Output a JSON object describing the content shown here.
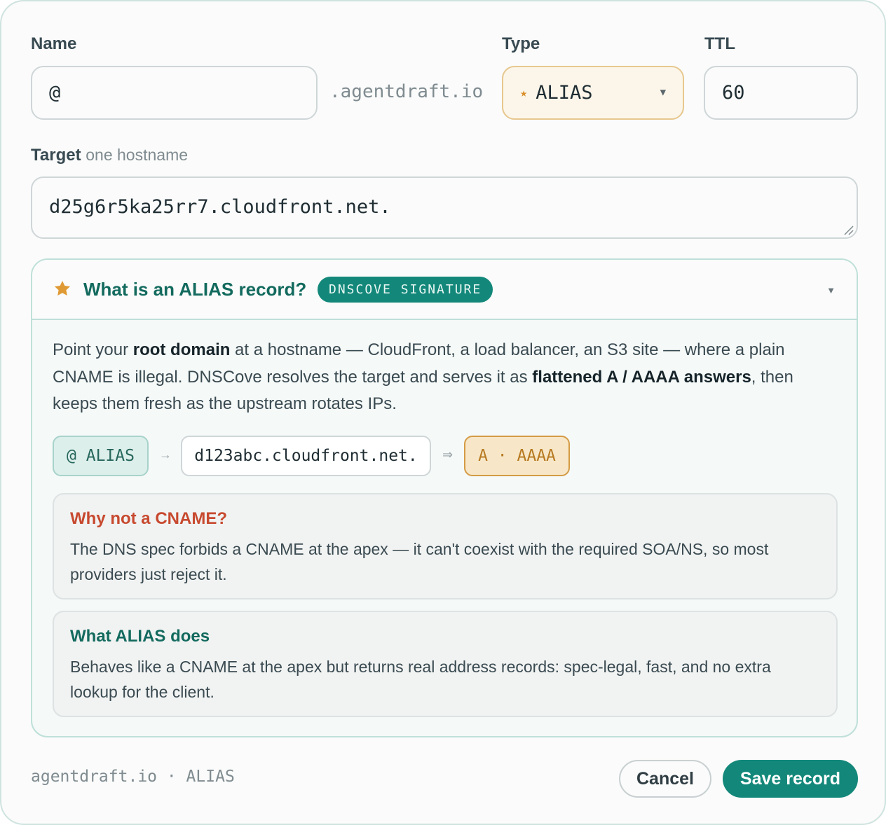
{
  "form": {
    "name_label": "Name",
    "name_value": "@",
    "domain_suffix": ".agentdraft.io",
    "type_label": "Type",
    "type_value": "ALIAS",
    "type_icon": "star-icon",
    "ttl_label": "TTL",
    "ttl_value": "60",
    "target_label": "Target",
    "target_hint": "one hostname",
    "target_value": "d25g6r5ka25rr7.cloudfront.net."
  },
  "panel": {
    "title": "What is an ALIAS record?",
    "badge": "DNSCOVE SIGNATURE",
    "desc_1": "Point your ",
    "desc_b1": "root domain",
    "desc_2": " at a hostname — CloudFront, a load balancer, an S3 site — where a plain CNAME is illegal. DNSCove resolves the target and serves it as ",
    "desc_b2": "flattened A / AAAA answers",
    "desc_3": ", then keeps them fresh as the upstream rotates IPs.",
    "flow": {
      "alias_chip": "@ ALIAS",
      "arrow_1": "→",
      "target_chip": "d123abc.cloudfront.net.",
      "arrow_2": "⇒",
      "answer_chip": "A · AAAA"
    },
    "notes": [
      {
        "title": "Why not a CNAME?",
        "body": "The DNS spec forbids a CNAME at the apex — it can't coexist with the required SOA/NS, so most providers just reject it."
      },
      {
        "title": "What ALIAS does",
        "body": "Behaves like a CNAME at the apex but returns real address records: spec-legal, fast, and no extra lookup for the client."
      }
    ]
  },
  "footer": {
    "meta": "agentdraft.io · ALIAS",
    "cancel_label": "Cancel",
    "save_label": "Save record"
  },
  "colors": {
    "accent": "#13887a",
    "accent_dark": "#136a5e",
    "star": "#e09a35",
    "warning": "#c7492f",
    "answer": "#b77920"
  }
}
